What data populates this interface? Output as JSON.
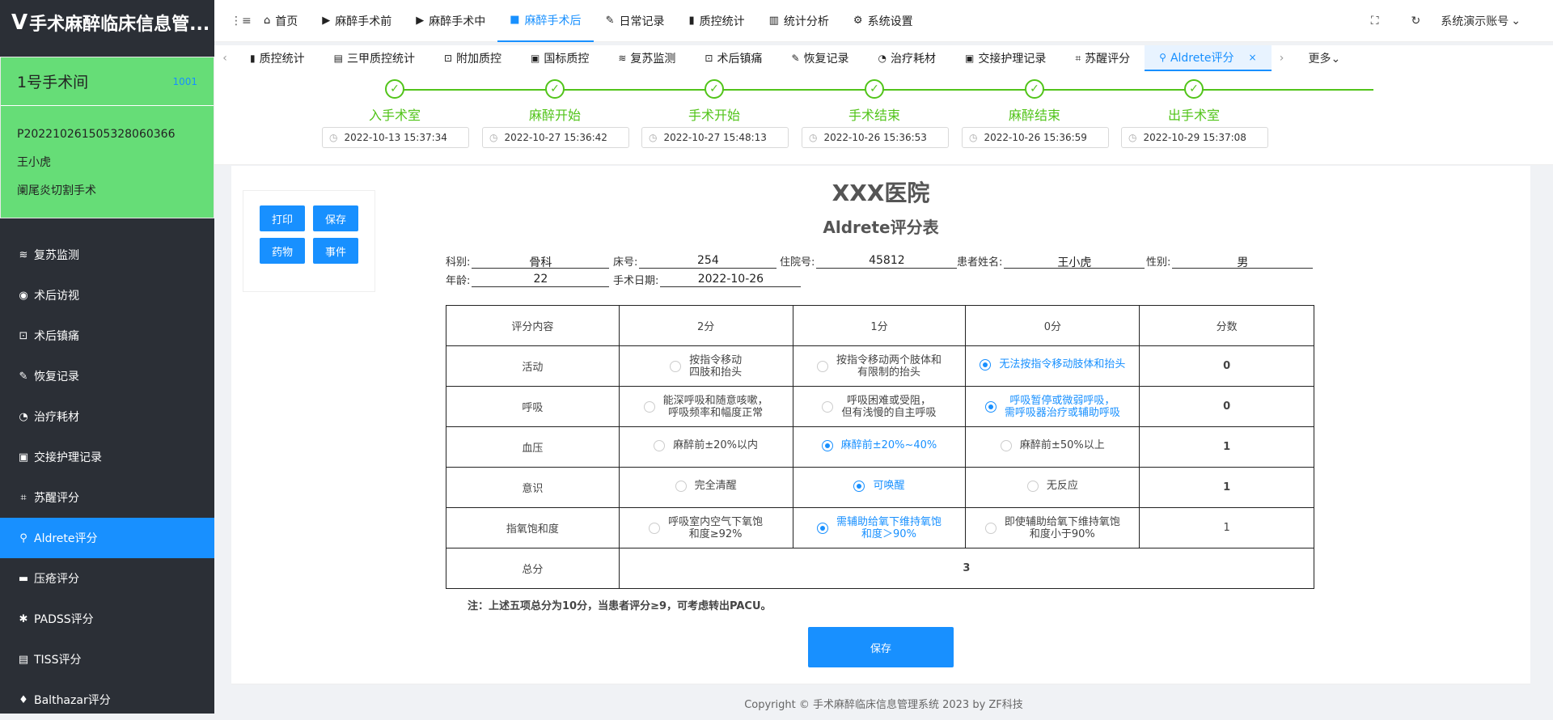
{
  "app": {
    "logo_mark": "V",
    "title": "手术麻醉临床信息管..."
  },
  "room": {
    "name": "1号手术间",
    "code": "1001",
    "patient_id": "P20221026150532806036​6",
    "patient_name": "王小虎",
    "surgery": "阑尾炎切割手术"
  },
  "sidebar": {
    "items": [
      {
        "label": "复苏监测",
        "icon": "≋"
      },
      {
        "label": "术后访视",
        "icon": "◉"
      },
      {
        "label": "术后镇痛",
        "icon": "⊡"
      },
      {
        "label": "恢复记录",
        "icon": "✎"
      },
      {
        "label": "治疗耗材",
        "icon": "◔"
      },
      {
        "label": "交接护理记录",
        "icon": "▣"
      },
      {
        "label": "苏醒评分",
        "icon": "⌗"
      },
      {
        "label": "Aldrete评分",
        "icon": "⚲"
      },
      {
        "label": "压疮评分",
        "icon": "▬"
      },
      {
        "label": "PADSS评分",
        "icon": "✱"
      },
      {
        "label": "TISS评分",
        "icon": "▤"
      },
      {
        "label": "Balthazar评分",
        "icon": "♦"
      }
    ]
  },
  "topnav": {
    "collapse_icon": "⋮≡",
    "items": [
      {
        "label": "首页",
        "icon": "⌂"
      },
      {
        "label": "麻醉手术前",
        "icon": "▶"
      },
      {
        "label": "麻醉手术中",
        "icon": "▶"
      },
      {
        "label": "麻醉手术后",
        "icon": "■"
      },
      {
        "label": "日常记录",
        "icon": "✎"
      },
      {
        "label": "质控统计",
        "icon": "▮"
      },
      {
        "label": "统计分析",
        "icon": "▥"
      },
      {
        "label": "系统设置",
        "icon": "⚙"
      }
    ],
    "fullscreen_icon": "⛶",
    "account": "系统演示账号",
    "account_icon": "↻",
    "account_arrow": "⌄"
  },
  "tabs": {
    "left_arrow": "‹",
    "right_arrow": "›",
    "items": [
      {
        "label": "质控统计",
        "icon": "▮"
      },
      {
        "label": "三甲质控统计",
        "icon": "▤"
      },
      {
        "label": "附加质控",
        "icon": "⊡"
      },
      {
        "label": "国标质控",
        "icon": "▣"
      },
      {
        "label": "复苏监测",
        "icon": "≋"
      },
      {
        "label": "术后镇痛",
        "icon": "⊡"
      },
      {
        "label": "恢复记录",
        "icon": "✎"
      },
      {
        "label": "治疗耗材",
        "icon": "◔"
      },
      {
        "label": "交接护理记录",
        "icon": "▣"
      },
      {
        "label": "苏醒评分",
        "icon": "⌗"
      },
      {
        "label": "Aldrete评分",
        "icon": "⚲"
      }
    ],
    "close_icon": "×",
    "more": "更多⌄"
  },
  "steps": [
    {
      "label": "入手术室",
      "time": "2022-10-13 15:37:34"
    },
    {
      "label": "麻醉开始",
      "time": "2022-10-27 15:36:42"
    },
    {
      "label": "手术开始",
      "time": "2022-10-27 15:48:13"
    },
    {
      "label": "手术结束",
      "time": "2022-10-26 15:36:53"
    },
    {
      "label": "麻醉结束",
      "time": "2022-10-26 15:36:59"
    },
    {
      "label": "出手术室",
      "time": "2022-10-29 15:37:08"
    }
  ],
  "step_check": "✓",
  "step_clock": "◷",
  "controls": {
    "print": "打印",
    "save": "保存",
    "drug": "药物",
    "event": "事件"
  },
  "hospital": "XXX医院",
  "form_title": "Aldrete评分表",
  "patient": {
    "dept_label": "科别:",
    "dept": "骨科",
    "bed_label": "床号:",
    "bed": "254",
    "admission_label": "住院号:",
    "admission": "45812",
    "name_label": "患者姓名:",
    "name": "王小虎",
    "sex_label": "性别:",
    "sex": "男",
    "age_label": "年龄:",
    "age": "22",
    "date_label": "手术日期:",
    "date": "2022-10-26"
  },
  "table": {
    "headers": [
      "评分内容",
      "2分",
      "1分",
      "0分",
      "分数"
    ],
    "rows": [
      {
        "item": "活动",
        "options": [
          "按指令移动\n四肢和抬头",
          "按指令移动两个肢体和\n有限制的抬头",
          "无法按指令移动肢体和抬头"
        ],
        "selected": 2,
        "score": "0",
        "bold": true
      },
      {
        "item": "呼吸",
        "options": [
          "能深呼吸和随意咳嗽，\n呼吸频率和幅度正常",
          "呼吸困难或受阻，\n但有浅慢的自主呼吸",
          "呼吸暂停或微弱呼吸，\n需呼吸器治疗或辅助呼吸"
        ],
        "selected": 2,
        "score": "0",
        "bold": true
      },
      {
        "item": "血压",
        "options": [
          "麻醉前±20%以内",
          "麻醉前±20%~40%",
          "麻醉前±50%以上"
        ],
        "selected": 1,
        "score": "1",
        "bold": true
      },
      {
        "item": "意识",
        "options": [
          "完全清醒",
          "可唤醒",
          "无反应"
        ],
        "selected": 1,
        "score": "1",
        "bold": true
      },
      {
        "item": "指氧饱和度",
        "options": [
          "呼吸室内空气下氧饱\n和度≥92%",
          "需辅助给氧下维持氧饱\n和度＞90%",
          "即使辅助给氧下维持氧饱\n和度小于90%"
        ],
        "selected": 1,
        "score": "1",
        "bold": false
      }
    ],
    "total_label": "总分",
    "total": "3"
  },
  "note": "注：上述五项总分为10分，当患者评分≥9，可考虑转出PACU。",
  "save_big": "保存",
  "footer": "Copyright © 手术麻醉临床信息管理系统 2023 by ZF科技"
}
